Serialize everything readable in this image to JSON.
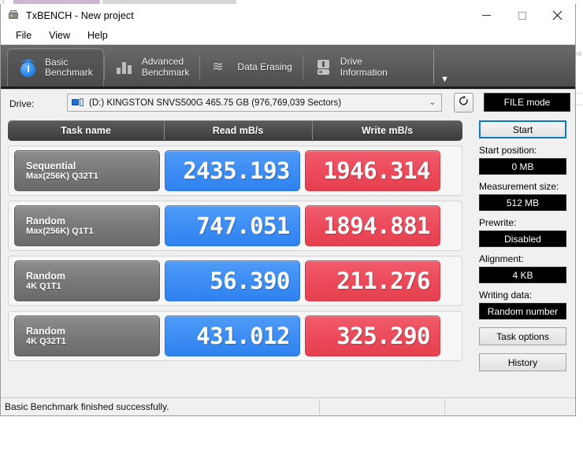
{
  "window": {
    "title": "TxBENCH - New project",
    "app_icon": "app-icon",
    "minimize": "–",
    "maximize": "□",
    "close": "✕"
  },
  "menubar": {
    "items": [
      {
        "label": "File"
      },
      {
        "label": "View"
      },
      {
        "label": "Help"
      }
    ]
  },
  "ribbon": {
    "tabs": [
      {
        "label": "Basic\nBenchmark",
        "icon": "stopwatch-icon",
        "active": true
      },
      {
        "label": "Advanced\nBenchmark",
        "icon": "bar-chart-icon",
        "active": false
      },
      {
        "label": "Data Erasing",
        "icon": "zigzag-icon",
        "active": false
      },
      {
        "label": "Drive\nInformation",
        "icon": "drive-icon",
        "active": false
      }
    ],
    "overflow_icon": "chevron-down-icon"
  },
  "drive": {
    "label": "Drive:",
    "selected": "(D:) KINGSTON SNVS500G  465.75 GB (976,769,039 Sectors)",
    "icon": "drive-volume-icon",
    "caret_icon": "chevron-down-icon",
    "refresh_icon": "refresh-icon",
    "file_mode_label": "FILE mode"
  },
  "results": {
    "columns": [
      "Task name",
      "Read mB/s",
      "Write mB/s"
    ],
    "rows": [
      {
        "name_line1": "Sequential",
        "name_line2": "Max(256K) Q32T1",
        "read": "2435.193",
        "write": "1946.314"
      },
      {
        "name_line1": "Random",
        "name_line2": "Max(256K) Q1T1",
        "read": "747.051",
        "write": "1894.881"
      },
      {
        "name_line1": "Random",
        "name_line2": "4K Q1T1",
        "read": "56.390",
        "write": "211.276"
      },
      {
        "name_line1": "Random",
        "name_line2": "4K Q32T1",
        "read": "431.012",
        "write": "325.290"
      }
    ]
  },
  "sidebar": {
    "start_label": "Start",
    "fields": [
      {
        "label": "Start position:",
        "value": "0 MB"
      },
      {
        "label": "Measurement size:",
        "value": "512 MB"
      },
      {
        "label": "Prewrite:",
        "value": "Disabled"
      },
      {
        "label": "Alignment:",
        "value": "4 KB"
      },
      {
        "label": "Writing data:",
        "value": "Random number"
      }
    ],
    "buttons": [
      {
        "label": "Task options"
      },
      {
        "label": "History"
      }
    ]
  },
  "statusbar": {
    "message": "Basic Benchmark finished successfully."
  },
  "background": {
    "edge_text": "ane"
  },
  "colors": {
    "read_accent": "#3d8df4",
    "write_accent": "#ec4b5c",
    "start_border": "#0a7ac4",
    "ribbon_bg": "#5d5d5d"
  }
}
